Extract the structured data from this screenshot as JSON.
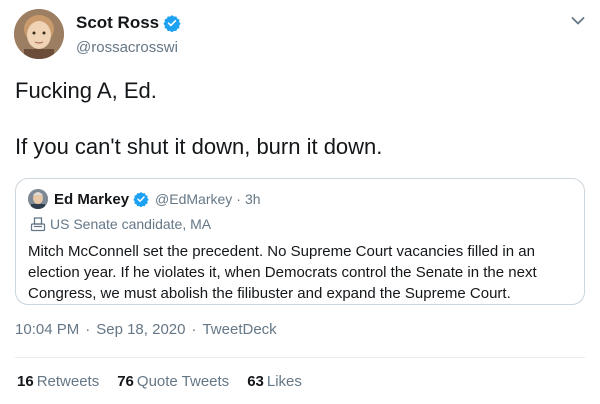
{
  "tweet": {
    "author_name": "Scot Ross",
    "author_handle": "@rossacrosswi",
    "text_line1": "Fucking A, Ed.",
    "text_line2": "If you can't shut it down, burn it down.",
    "timestamp": "10:04 PM",
    "date": "Sep 18, 2020",
    "source": "TweetDeck",
    "separator": "·"
  },
  "quote": {
    "author_name": "Ed Markey",
    "author_handle": "@EdMarkey",
    "time": "3h",
    "label": "US Senate candidate, MA",
    "body": "Mitch McConnell set the precedent. No Supreme Court vacancies filled in an election year. If he violates it, when Democrats control the Senate in the next Congress, we must abolish the filibuster and expand the Supreme Court."
  },
  "stats": {
    "retweets_count": "16",
    "retweets_label": "Retweets",
    "quotes_count": "76",
    "quotes_label": "Quote Tweets",
    "likes_count": "63",
    "likes_label": "Likes"
  },
  "colors": {
    "verified": "#1da1f2",
    "secondary_text": "#657786",
    "primary_text": "#14171a",
    "border": "#ccd6dd"
  },
  "icons": {
    "verified": "verified-badge-icon",
    "caret": "chevron-down-icon",
    "ballot": "ballot-box-icon"
  }
}
